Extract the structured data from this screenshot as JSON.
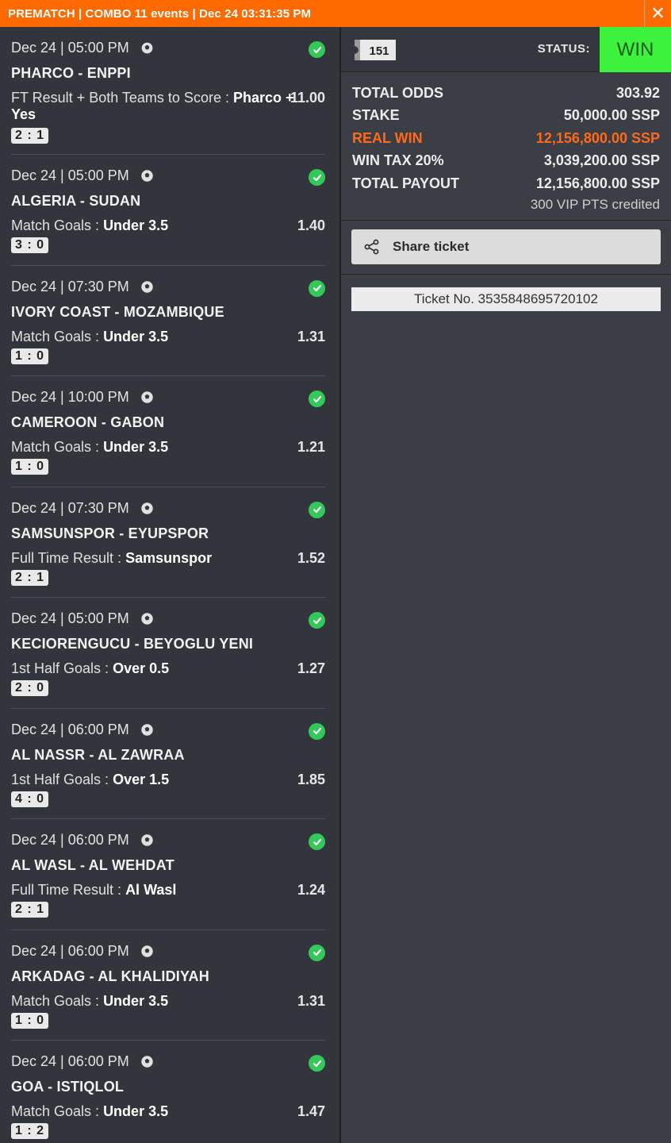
{
  "header": {
    "title": "PREMATCH | COMBO 11 events | Dec 24 03:31:35 PM",
    "close_icon": "close-icon"
  },
  "events": [
    {
      "date": "Dec 24 | 05:00 PM",
      "teams": "PHARCO - ENPPI",
      "market_label": "FT Result + Both Teams to Score",
      "selection": "Pharco +",
      "odds": "11.00",
      "selection_extra": "Yes",
      "score": "2 : 1"
    },
    {
      "date": "Dec 24 | 05:00 PM",
      "teams": "ALGERIA - SUDAN",
      "market_label": "Match Goals",
      "selection": "Under 3.5",
      "odds": "1.40",
      "score": "3 : 0"
    },
    {
      "date": "Dec 24 | 07:30 PM",
      "teams": "IVORY COAST - MOZAMBIQUE",
      "market_label": "Match Goals",
      "selection": "Under 3.5",
      "odds": "1.31",
      "score": "1 : 0"
    },
    {
      "date": "Dec 24 | 10:00 PM",
      "teams": "CAMEROON - GABON",
      "market_label": "Match Goals",
      "selection": "Under 3.5",
      "odds": "1.21",
      "score": "1 : 0"
    },
    {
      "date": "Dec 24 | 07:30 PM",
      "teams": "SAMSUNSPOR - EYUPSPOR",
      "market_label": "Full Time Result",
      "selection": "Samsunspor",
      "odds": "1.52",
      "score": "2 : 1"
    },
    {
      "date": "Dec 24 | 05:00 PM",
      "teams": "KECIORENGUCU - BEYOGLU YENI",
      "market_label": "1st Half Goals",
      "selection": "Over 0.5",
      "odds": "1.27",
      "score": "2 : 0"
    },
    {
      "date": "Dec 24 | 06:00 PM",
      "teams": "AL NASSR - AL ZAWRAA",
      "market_label": "1st Half Goals",
      "selection": "Over 1.5",
      "odds": "1.85",
      "score": "4 : 0"
    },
    {
      "date": "Dec 24 | 06:00 PM",
      "teams": "AL WASL - AL WEHDAT",
      "market_label": "Full Time Result",
      "selection": "Al Wasl",
      "odds": "1.24",
      "score": "2 : 1"
    },
    {
      "date": "Dec 24 | 06:00 PM",
      "teams": "ARKADAG - AL KHALIDIYAH",
      "market_label": "Match Goals",
      "selection": "Under 3.5",
      "odds": "1.31",
      "score": "1 : 0"
    },
    {
      "date": "Dec 24 | 06:00 PM",
      "teams": "GOA - ISTIQLOL",
      "market_label": "Match Goals",
      "selection": "Under 3.5",
      "odds": "1.47",
      "score": "1 : 2"
    }
  ],
  "ticket": {
    "badge_count": "151",
    "status_label": "STATUS:",
    "status_value": "WIN",
    "status_color": "#3df23d",
    "accent_color": "#ff6a00"
  },
  "summary": {
    "total_odds_label": "TOTAL ODDS",
    "total_odds": "303.92",
    "stake_label": "STAKE",
    "stake": "50,000.00 SSP",
    "real_win_label": "REAL WIN",
    "real_win": "12,156,800.00 SSP",
    "win_tax_label": "WIN TAX 20%",
    "win_tax": "3,039,200.00 SSP",
    "total_payout_label": "TOTAL PAYOUT",
    "total_payout": "12,156,800.00 SSP",
    "vip_note": "300 VIP PTS credited"
  },
  "share": {
    "label": "Share ticket",
    "icon": "share-icon"
  },
  "ticket_number": "Ticket No. 3535848695720102"
}
